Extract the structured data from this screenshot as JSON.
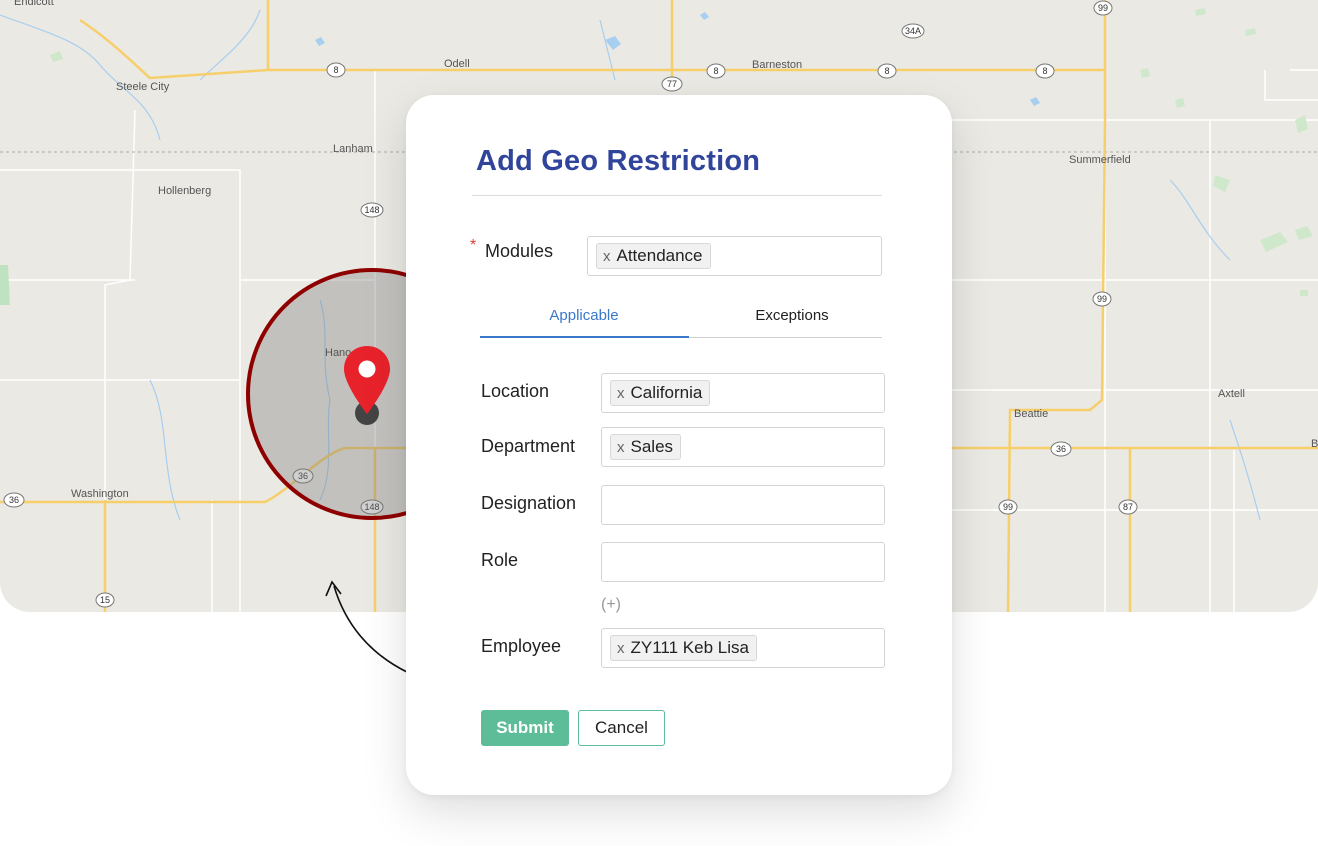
{
  "map": {
    "towns": [
      "Endicott",
      "Steele City",
      "Odell",
      "Barneston",
      "Lanham",
      "Hollenberg",
      "Summerfield",
      "Hano",
      "Beattie",
      "Axtell",
      "Washington",
      "B"
    ],
    "shields": [
      "8",
      "8",
      "8",
      "8",
      "77",
      "99",
      "34A",
      "148",
      "148",
      "99",
      "36",
      "36",
      "36",
      "99",
      "87",
      "15"
    ],
    "colors": {
      "land": "#ebe9e3",
      "road": "#f6cf6b",
      "water": "#a8cef0",
      "radius_ring": "#8e0000",
      "pin": "#e8222a"
    }
  },
  "dialog": {
    "title": "Add Geo Restriction",
    "modules": {
      "label": "Modules",
      "required_mark": "*",
      "chips": [
        "Attendance"
      ]
    },
    "tabs": [
      {
        "label": "Applicable",
        "active": true
      },
      {
        "label": "Exceptions",
        "active": false
      }
    ],
    "fields": {
      "location": {
        "label": "Location",
        "chip": "California"
      },
      "department": {
        "label": "Department",
        "chip": "Sales"
      },
      "designation": {
        "label": "Designation",
        "value": ""
      },
      "role": {
        "label": "Role",
        "value": ""
      },
      "employee": {
        "label": "Employee",
        "chip": "ZY111 Keb Lisa"
      }
    },
    "chip_remove_glyph": "x",
    "add_more": "(+)",
    "buttons": {
      "submit": "Submit",
      "cancel": "Cancel"
    },
    "colors": {
      "title": "#31449b",
      "active_tab": "#3a78c9",
      "submit": "#5cbd98"
    }
  }
}
